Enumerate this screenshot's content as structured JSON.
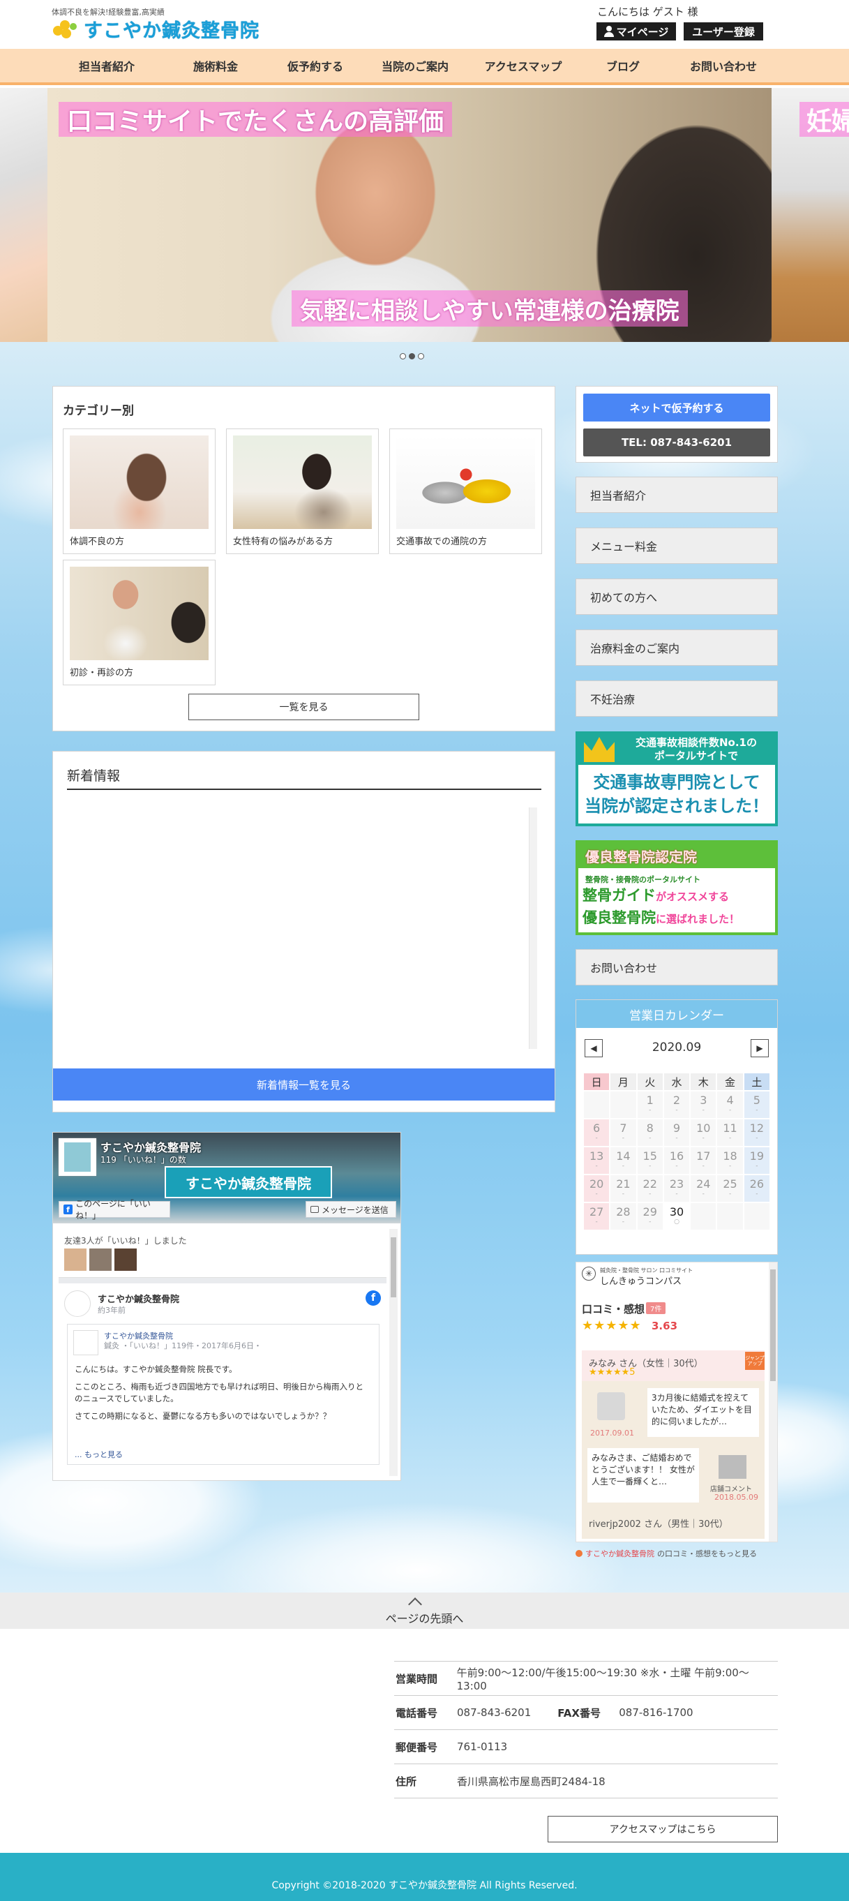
{
  "header": {
    "tagline": "体調不良を解決!経験豊富,高実績",
    "logo_text": "すこやか鍼灸整骨院",
    "greeting": "こんにちは ゲスト 様",
    "mypage_label": "マイページ",
    "register_label": "ユーザー登録"
  },
  "nav": {
    "items": [
      "担当者紹介",
      "施術料金",
      "仮予約する",
      "当院のご案内",
      "アクセスマップ",
      "ブログ",
      "お問い合わせ"
    ]
  },
  "hero": {
    "caption_top": "口コミサイトでたくさんの高評価",
    "caption_bottom": "気軽に相談しやすい常連様の治療院",
    "caption_next": "妊婦"
  },
  "categories": {
    "title": "カテゴリー別",
    "items": [
      "体調不良の方",
      "女性特有の悩みがある方",
      "交通事故での通院の方",
      "初診・再診の方"
    ],
    "more_label": "一覧を見る"
  },
  "news": {
    "title": "新着情報",
    "button_label": "新着情報一覧を見る"
  },
  "facebook": {
    "page_name": "すこやか鍼灸整骨院",
    "likes": "119 「いいね！」の数",
    "like_button": "このページに「いいね！」",
    "message_button": "メッセージを送信",
    "sign_text": "すこやか鍼灸整骨院",
    "friends_text": "友達3人が「いいね！」しました",
    "post_name": "すこやか鍼灸整骨院",
    "post_time": "約3年前",
    "shared_name": "すこやか鍼灸整骨院",
    "shared_meta1": "鍼灸 ・「いいね！」119件・2017年6月6日・",
    "shared_text": [
      "こんにちは。すこやか鍼灸整骨院 院長です。",
      "ここのところ、梅雨も近づき四国地方でも早ければ明日、明後日から梅雨入りとのニュースでしていました。",
      "さてこの時期になると、憂鬱になる方も多いのではないでしょうか？？"
    ],
    "more_text": "... もっと見る"
  },
  "sidebar": {
    "reserve_label": "ネットで仮予約する",
    "tel_label": "TEL: 087-843-6201",
    "links": [
      "担当者紹介",
      "メニュー料金",
      "初めての方へ",
      "治療料金のご案内",
      "不妊治療"
    ],
    "banner1_line1": "交通事故相談件数No.1の",
    "banner1_line2": "ポータルサイトで",
    "banner1_line3": "交通事故専門院として",
    "banner1_line4": "当院が認定されました！",
    "banner2_title": "優良整骨院認定院",
    "banner2_sub": "整骨院・接骨院のポータルサイト",
    "banner2_main1": "整骨ガイド",
    "banner2_main1b": "がオススメする",
    "banner2_main2": "優良整骨院",
    "banner2_main2b": "に選ばれました！",
    "contact_label": "お問い合わせ"
  },
  "calendar": {
    "title": "営業日カレンダー",
    "month": "2020.09",
    "prev": "◀",
    "next": "▶",
    "weekdays": [
      "日",
      "月",
      "火",
      "水",
      "木",
      "金",
      "土"
    ],
    "days": [
      "",
      "",
      "1",
      "2",
      "3",
      "4",
      "5",
      "6",
      "7",
      "8",
      "9",
      "10",
      "11",
      "12",
      "13",
      "14",
      "15",
      "16",
      "17",
      "18",
      "19",
      "20",
      "21",
      "22",
      "23",
      "24",
      "25",
      "26",
      "27",
      "28",
      "29",
      "30",
      "",
      "",
      ""
    ],
    "today": "30",
    "today_mark": "○",
    "closed_mark": "-"
  },
  "review": {
    "site_small": "鍼灸院・整骨院 サロン 口コミサイト",
    "site_name": "しんきゅうコンパス",
    "title": "口コミ・感想",
    "count": "7件",
    "stars": "★★★★★",
    "score": "3.63",
    "user1": "みなみ さん（女性｜30代）",
    "user1_stars": "★★★★★5",
    "badge": "ジャンプアップ",
    "quote": "3カ月後に結婚式を控えていたため、ダイエットを目的に伺いましたが…",
    "date1": "2017.09.01",
    "reply": "みなみさま、ご結婚おめでとうございます！！ 女性が人生で一番輝くと…",
    "reply_label": "店舗コメント",
    "date2": "2018.05.09",
    "user2": "riverjp2002 さん（男性｜30代）",
    "more_prefix": "すこやか鍼灸整骨院",
    "more_suffix": "の口コミ・感想をもっと見る"
  },
  "pagetop": {
    "label": "ページの先頭へ"
  },
  "info": {
    "hours_label": "営業時間",
    "hours": "午前9:00〜12:00/午後15:00〜19:30 ※水・土曜 午前9:00〜13:00",
    "tel_label": "電話番号",
    "tel": "087-843-6201",
    "fax_label": "FAX番号",
    "fax": "087-816-1700",
    "zip_label": "郵便番号",
    "zip": "761-0113",
    "address_label": "住所",
    "address": "香川県高松市屋島西町2484-18",
    "access_label": "アクセスマップはこちら"
  },
  "footer": {
    "copyright": "Copyright ©2018-2020 すこやか鍼灸整骨院 All Rights Reserved."
  },
  "colors": {
    "nav_bg": "#fddcb9",
    "accent_blue": "#4a86f5",
    "footer_bg": "#29b0c6",
    "logo_blue": "#1a9fd8"
  }
}
